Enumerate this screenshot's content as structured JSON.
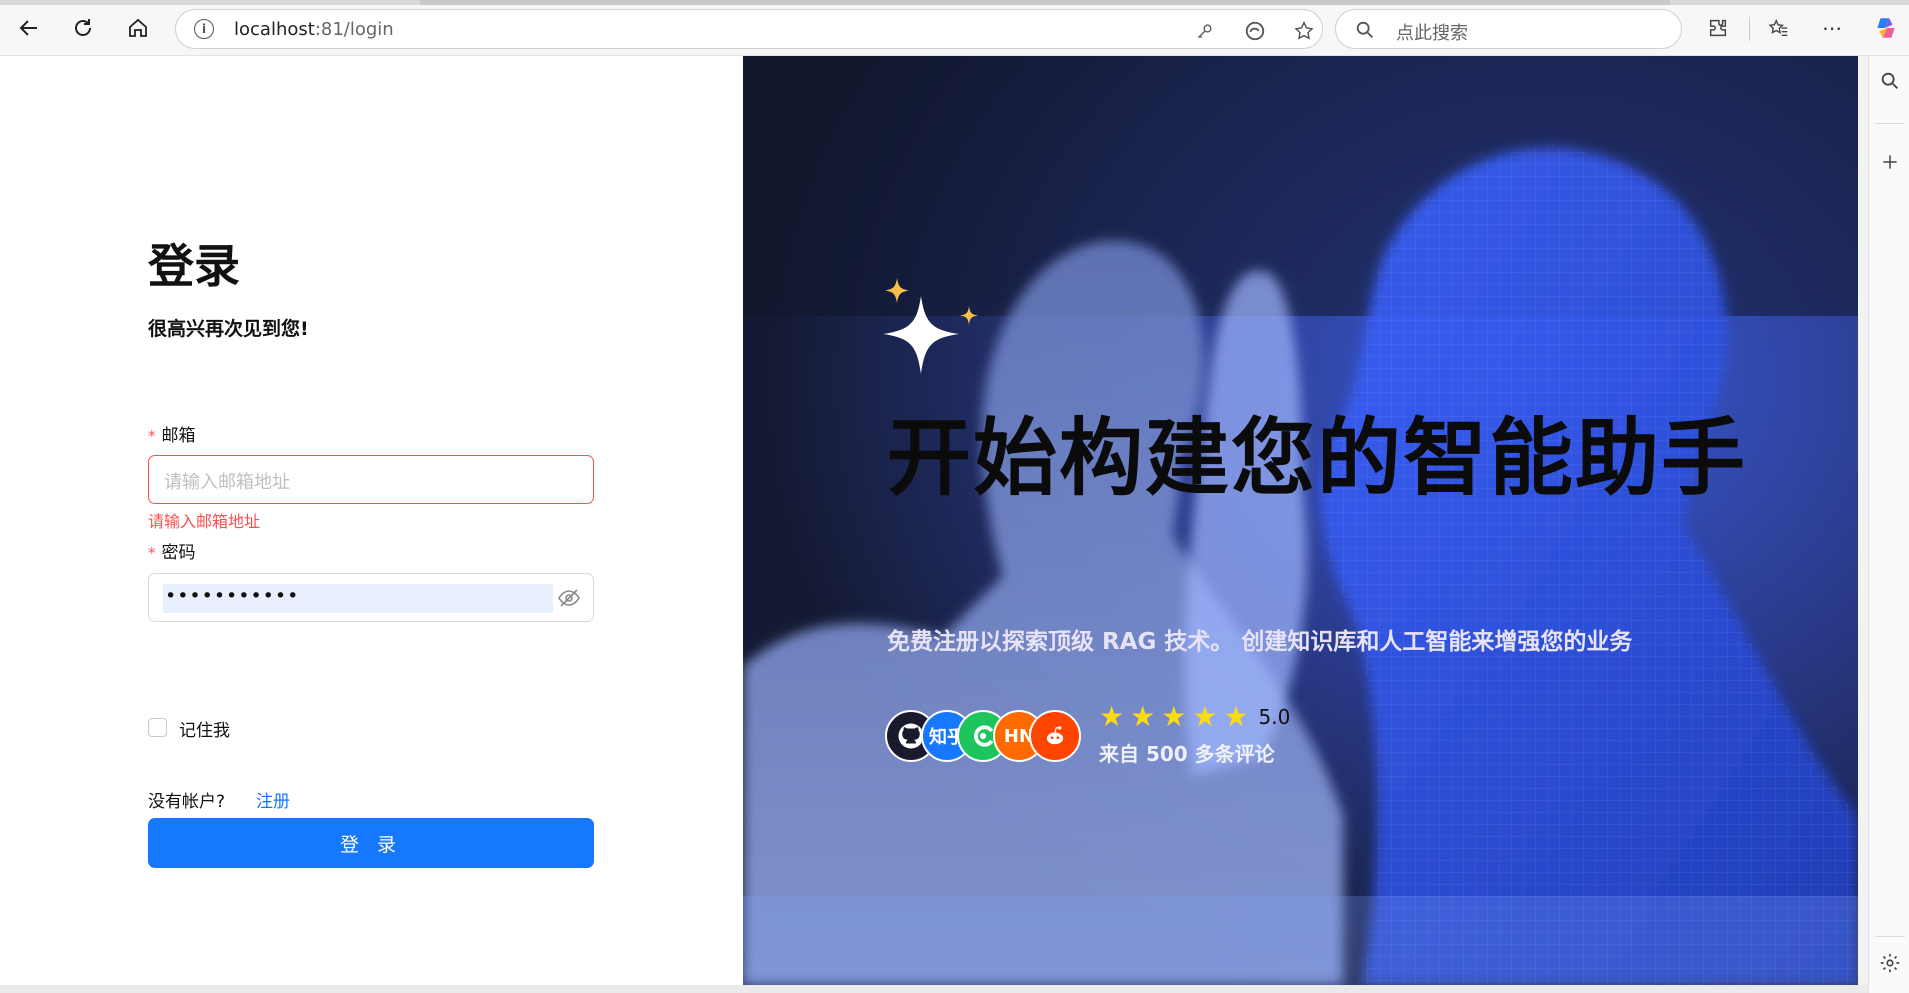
{
  "browser": {
    "url_host": "localhost",
    "url_rest": ":81/login",
    "search_placeholder": "点此搜索"
  },
  "login": {
    "title": "登录",
    "subtitle": "很高兴再次见到您!",
    "email_label": "邮箱",
    "required_mark": "*",
    "email_placeholder": "请输入邮箱地址",
    "email_error": "请输入邮箱地址",
    "password_label": "密码",
    "password_value": "•••••••••••",
    "remember_label": "记住我",
    "no_account_text": "没有帐户?",
    "register_link": "注册",
    "login_button": "登 录"
  },
  "hero": {
    "title": "开始构建您的智能助手",
    "subtitle": "免费注册以探索顶级 RAG 技术。 创建知识库和人工智能来增强您的业务",
    "rating_value": "5.0",
    "reviews_text": "来自 500 多条评论",
    "star_count": 5,
    "avatars": [
      {
        "icon": "github-icon",
        "text": "",
        "color": "#1a1a2e"
      },
      {
        "icon": "zhihu-icon",
        "text": "知乎",
        "color": "#1677ff"
      },
      {
        "icon": "wechat-icon",
        "text": "",
        "color": "#1ec55f"
      },
      {
        "icon": "hackernews-icon",
        "text": "HN",
        "color": "#ff6a00"
      },
      {
        "icon": "reddit-icon",
        "text": "",
        "color": "#ff4500"
      }
    ]
  },
  "colors": {
    "primary": "#1677ff",
    "error": "#ff4d4f",
    "star": "#fadb14"
  }
}
